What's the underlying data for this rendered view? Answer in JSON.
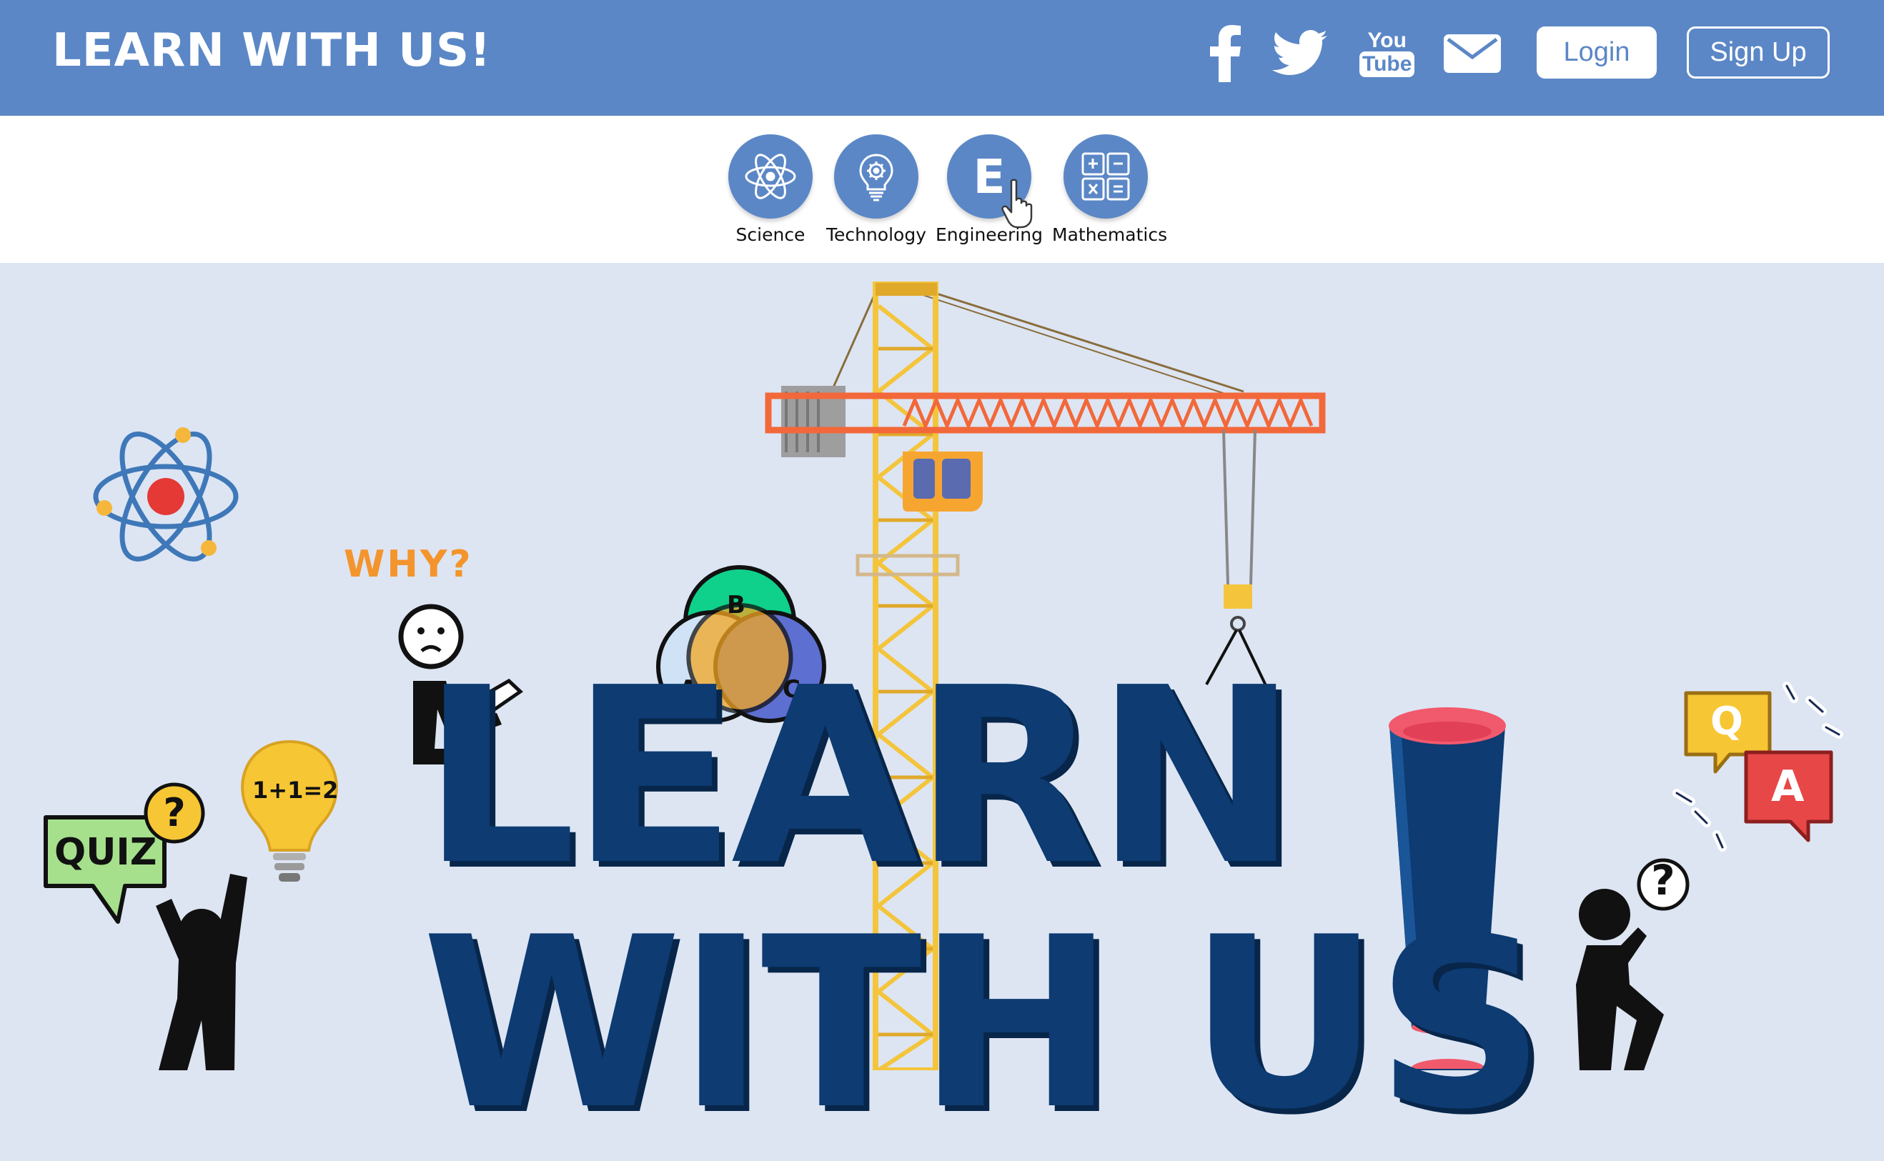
{
  "header": {
    "brand": "LEARN WITH US!",
    "login_label": "Login",
    "signup_label": "Sign Up",
    "social": [
      {
        "icon": "facebook-icon"
      },
      {
        "icon": "twitter-icon"
      },
      {
        "icon": "youtube-icon",
        "text_top": "You",
        "text_bottom": "Tube"
      },
      {
        "icon": "mail-icon"
      }
    ],
    "colors": {
      "primary": "#5b87c6",
      "hero_bg": "#dde5f3",
      "navy": "#0d3b72"
    }
  },
  "subjects": [
    {
      "label": "Science",
      "icon": "atom-icon"
    },
    {
      "label": "Technology",
      "icon": "lightbulb-gear-icon"
    },
    {
      "label": "Engineering",
      "icon": "letter-e-icon",
      "glyph": "E"
    },
    {
      "label": "Mathematics",
      "icon": "calculator-icon"
    }
  ],
  "hero": {
    "headline_line1": "LEARN",
    "headline_line2": "WITH US",
    "exclamation": "!",
    "why_text": "WHY?",
    "quiz_text": "QUIZ",
    "bulb_text": "1+1=2",
    "venn": [
      "A",
      "B",
      "C"
    ],
    "qa": [
      "Q",
      "A"
    ],
    "question_mark": "?"
  }
}
